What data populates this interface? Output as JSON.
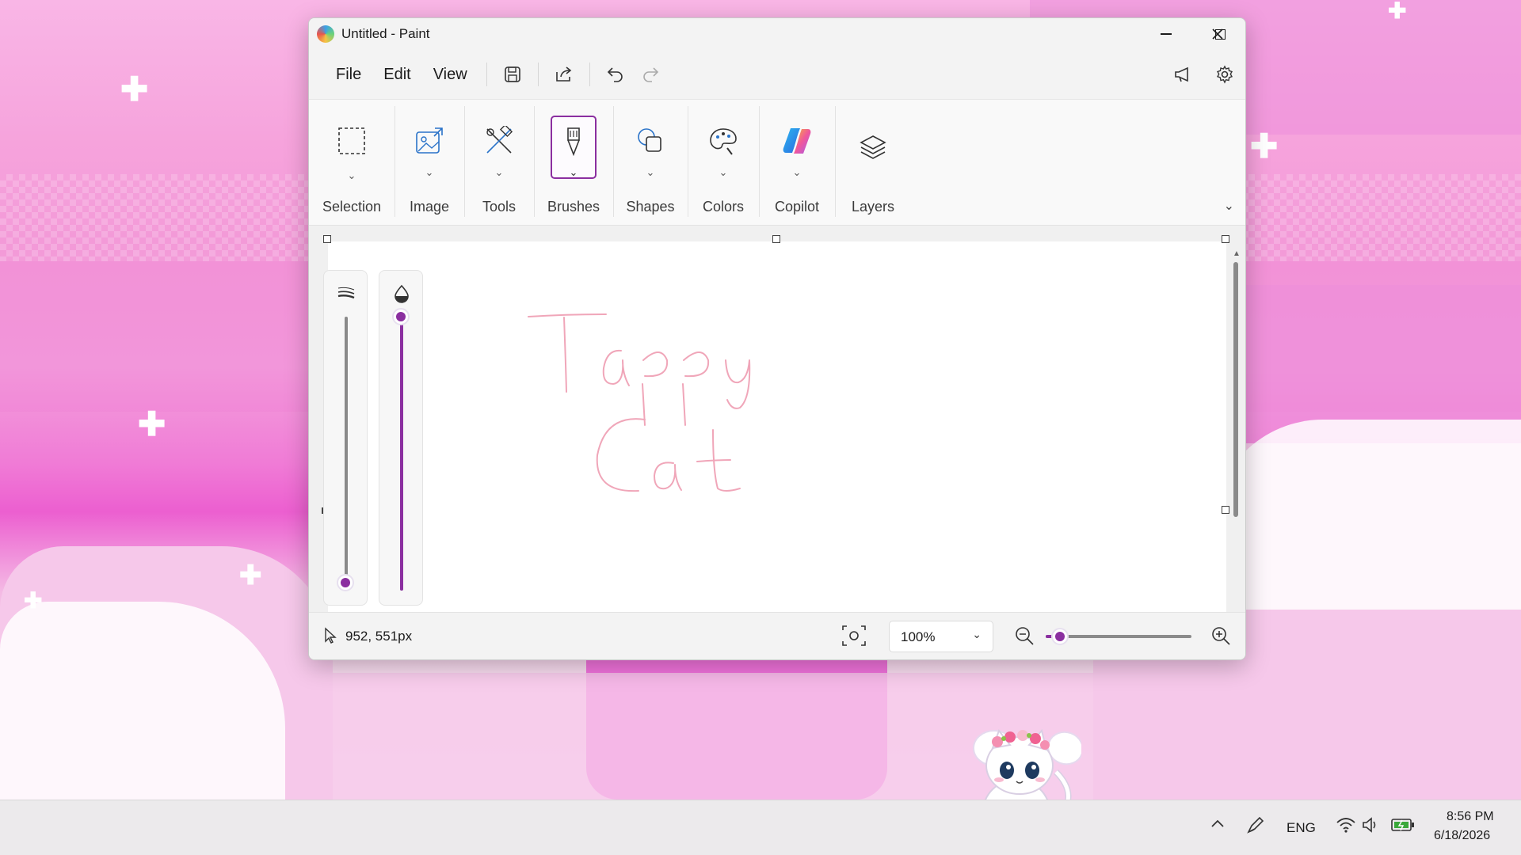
{
  "window": {
    "title": "Untitled - Paint",
    "controls": {
      "minimize": "—",
      "maximize": "☐",
      "close": "✕"
    }
  },
  "menu": {
    "file": "File",
    "edit": "Edit",
    "view": "View"
  },
  "ribbon": {
    "groups": [
      {
        "label": "Selection",
        "icon": "selection-icon"
      },
      {
        "label": "Image",
        "icon": "image-icon"
      },
      {
        "label": "Tools",
        "icon": "tools-icon"
      },
      {
        "label": "Brushes",
        "icon": "brush-icon"
      },
      {
        "label": "Shapes",
        "icon": "shapes-icon"
      },
      {
        "label": "Colors",
        "icon": "palette-icon"
      },
      {
        "label": "Copilot",
        "icon": "copilot-icon"
      },
      {
        "label": "Layers",
        "icon": "layers-icon"
      }
    ],
    "selected": "Brushes"
  },
  "sliders": {
    "size": {
      "icon": "stroke-size-icon",
      "level": 0.03
    },
    "opacity": {
      "icon": "opacity-icon",
      "level": 1.0
    }
  },
  "canvas_drawing": {
    "line1": "Tappy",
    "line2": "Cat",
    "stroke_color": "#f0a6b9"
  },
  "status": {
    "cursor_position": "952, 551px",
    "zoom": "100%",
    "zoom_level": 0.1
  },
  "taskbar": {
    "language": "ENG",
    "time": "8:56 PM",
    "date": "6/18/2026"
  },
  "colors": {
    "accent": "#8b2fa0",
    "window_bg": "#f3f3f3",
    "canvas_bg": "#ffffff"
  }
}
